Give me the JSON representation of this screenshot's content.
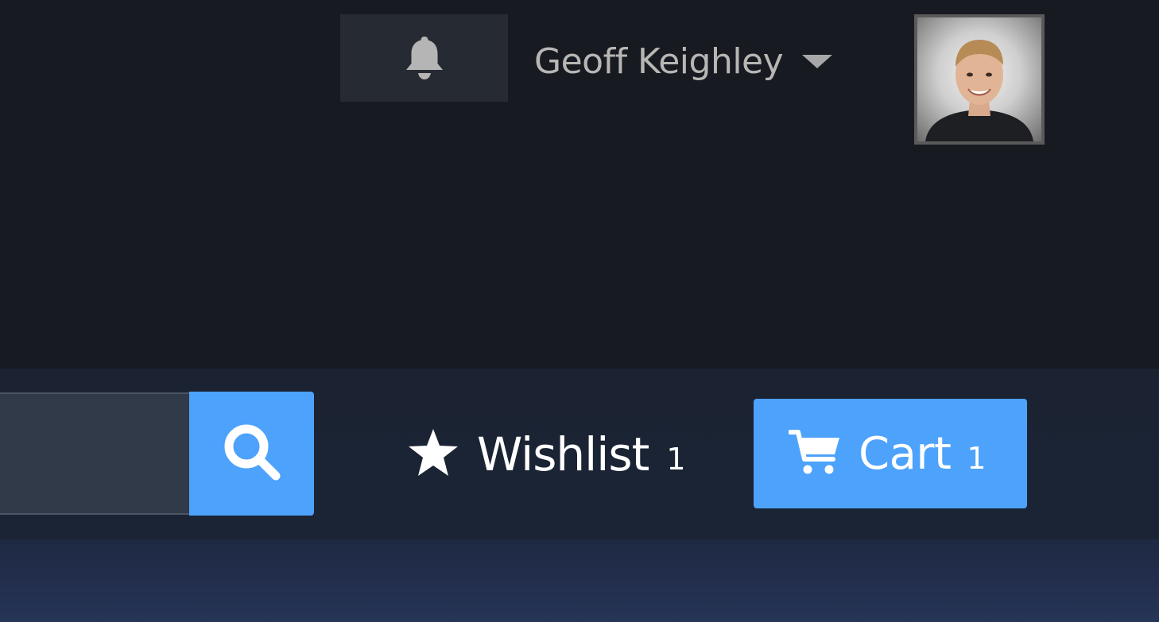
{
  "header": {
    "account_name": "Geoff Keighley"
  },
  "search": {
    "placeholder": ""
  },
  "nav": {
    "wishlist_label": "Wishlist",
    "wishlist_count": "1",
    "cart_label": "Cart",
    "cart_count": "1"
  },
  "icons": {
    "notification": "bell-icon",
    "account_dropdown": "chevron-down-icon",
    "search": "search-icon",
    "wishlist": "star-icon",
    "cart": "cart-icon"
  },
  "colors": {
    "page_background": "#171a21",
    "accent": "#4da2fb",
    "account_name": "#b8b6b4",
    "nav_background": "#1b2333"
  }
}
